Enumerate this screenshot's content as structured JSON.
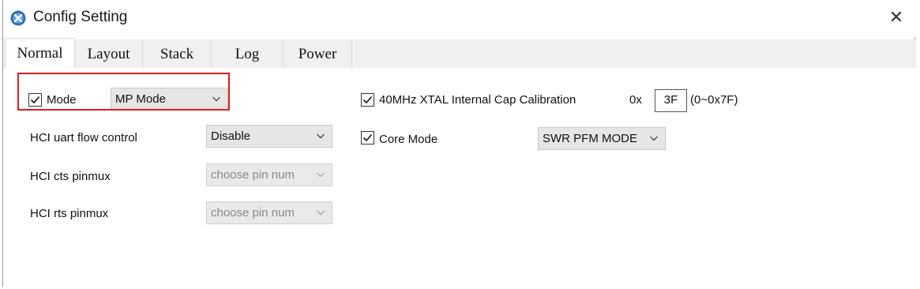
{
  "window": {
    "title": "Config Setting",
    "close_glyph": "✕"
  },
  "icons": {
    "app": "app-logo-icon",
    "close": "close-icon",
    "checkbox": "checkmark-icon",
    "dropdown": "chevron-down-icon"
  },
  "tabs": [
    {
      "label": "Normal",
      "active": true
    },
    {
      "label": "Layout",
      "active": false
    },
    {
      "label": "Stack",
      "active": false
    },
    {
      "label": "Log",
      "active": false
    },
    {
      "label": "Power",
      "active": false
    }
  ],
  "left": {
    "mode": {
      "label": "Mode",
      "checked": true,
      "value": "MP Mode"
    },
    "hci_uart_flow_control": {
      "label": "HCI uart flow control",
      "value": "Disable"
    },
    "hci_cts_pinmux": {
      "label": "HCI cts pinmux",
      "value": "choose pin num",
      "disabled": true
    },
    "hci_rts_pinmux": {
      "label": "HCI rts pinmux",
      "value": "choose pin num",
      "disabled": true
    }
  },
  "right": {
    "xtal_cal": {
      "label": "40MHz XTAL Internal Cap Calibration",
      "checked": true,
      "prefix": "0x",
      "value": "3F",
      "range": "(0~0x7F)"
    },
    "core_mode": {
      "label": "Core Mode",
      "checked": true,
      "value": "SWR PFM MODE"
    }
  },
  "colors": {
    "highlight": "#e31c1c",
    "tab_bg": "#f0f0f0",
    "select_bg": "#e6e6e6"
  }
}
